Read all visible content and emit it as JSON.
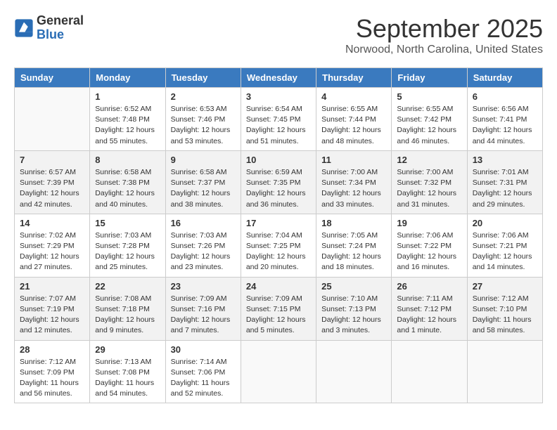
{
  "header": {
    "logo_general": "General",
    "logo_blue": "Blue",
    "month_title": "September 2025",
    "location": "Norwood, North Carolina, United States"
  },
  "days_of_week": [
    "Sunday",
    "Monday",
    "Tuesday",
    "Wednesday",
    "Thursday",
    "Friday",
    "Saturday"
  ],
  "weeks": [
    [
      {
        "day": "",
        "info": ""
      },
      {
        "day": "1",
        "info": "Sunrise: 6:52 AM\nSunset: 7:48 PM\nDaylight: 12 hours\nand 55 minutes."
      },
      {
        "day": "2",
        "info": "Sunrise: 6:53 AM\nSunset: 7:46 PM\nDaylight: 12 hours\nand 53 minutes."
      },
      {
        "day": "3",
        "info": "Sunrise: 6:54 AM\nSunset: 7:45 PM\nDaylight: 12 hours\nand 51 minutes."
      },
      {
        "day": "4",
        "info": "Sunrise: 6:55 AM\nSunset: 7:44 PM\nDaylight: 12 hours\nand 48 minutes."
      },
      {
        "day": "5",
        "info": "Sunrise: 6:55 AM\nSunset: 7:42 PM\nDaylight: 12 hours\nand 46 minutes."
      },
      {
        "day": "6",
        "info": "Sunrise: 6:56 AM\nSunset: 7:41 PM\nDaylight: 12 hours\nand 44 minutes."
      }
    ],
    [
      {
        "day": "7",
        "info": "Sunrise: 6:57 AM\nSunset: 7:39 PM\nDaylight: 12 hours\nand 42 minutes."
      },
      {
        "day": "8",
        "info": "Sunrise: 6:58 AM\nSunset: 7:38 PM\nDaylight: 12 hours\nand 40 minutes."
      },
      {
        "day": "9",
        "info": "Sunrise: 6:58 AM\nSunset: 7:37 PM\nDaylight: 12 hours\nand 38 minutes."
      },
      {
        "day": "10",
        "info": "Sunrise: 6:59 AM\nSunset: 7:35 PM\nDaylight: 12 hours\nand 36 minutes."
      },
      {
        "day": "11",
        "info": "Sunrise: 7:00 AM\nSunset: 7:34 PM\nDaylight: 12 hours\nand 33 minutes."
      },
      {
        "day": "12",
        "info": "Sunrise: 7:00 AM\nSunset: 7:32 PM\nDaylight: 12 hours\nand 31 minutes."
      },
      {
        "day": "13",
        "info": "Sunrise: 7:01 AM\nSunset: 7:31 PM\nDaylight: 12 hours\nand 29 minutes."
      }
    ],
    [
      {
        "day": "14",
        "info": "Sunrise: 7:02 AM\nSunset: 7:29 PM\nDaylight: 12 hours\nand 27 minutes."
      },
      {
        "day": "15",
        "info": "Sunrise: 7:03 AM\nSunset: 7:28 PM\nDaylight: 12 hours\nand 25 minutes."
      },
      {
        "day": "16",
        "info": "Sunrise: 7:03 AM\nSunset: 7:26 PM\nDaylight: 12 hours\nand 23 minutes."
      },
      {
        "day": "17",
        "info": "Sunrise: 7:04 AM\nSunset: 7:25 PM\nDaylight: 12 hours\nand 20 minutes."
      },
      {
        "day": "18",
        "info": "Sunrise: 7:05 AM\nSunset: 7:24 PM\nDaylight: 12 hours\nand 18 minutes."
      },
      {
        "day": "19",
        "info": "Sunrise: 7:06 AM\nSunset: 7:22 PM\nDaylight: 12 hours\nand 16 minutes."
      },
      {
        "day": "20",
        "info": "Sunrise: 7:06 AM\nSunset: 7:21 PM\nDaylight: 12 hours\nand 14 minutes."
      }
    ],
    [
      {
        "day": "21",
        "info": "Sunrise: 7:07 AM\nSunset: 7:19 PM\nDaylight: 12 hours\nand 12 minutes."
      },
      {
        "day": "22",
        "info": "Sunrise: 7:08 AM\nSunset: 7:18 PM\nDaylight: 12 hours\nand 9 minutes."
      },
      {
        "day": "23",
        "info": "Sunrise: 7:09 AM\nSunset: 7:16 PM\nDaylight: 12 hours\nand 7 minutes."
      },
      {
        "day": "24",
        "info": "Sunrise: 7:09 AM\nSunset: 7:15 PM\nDaylight: 12 hours\nand 5 minutes."
      },
      {
        "day": "25",
        "info": "Sunrise: 7:10 AM\nSunset: 7:13 PM\nDaylight: 12 hours\nand 3 minutes."
      },
      {
        "day": "26",
        "info": "Sunrise: 7:11 AM\nSunset: 7:12 PM\nDaylight: 12 hours\nand 1 minute."
      },
      {
        "day": "27",
        "info": "Sunrise: 7:12 AM\nSunset: 7:10 PM\nDaylight: 11 hours\nand 58 minutes."
      }
    ],
    [
      {
        "day": "28",
        "info": "Sunrise: 7:12 AM\nSunset: 7:09 PM\nDaylight: 11 hours\nand 56 minutes."
      },
      {
        "day": "29",
        "info": "Sunrise: 7:13 AM\nSunset: 7:08 PM\nDaylight: 11 hours\nand 54 minutes."
      },
      {
        "day": "30",
        "info": "Sunrise: 7:14 AM\nSunset: 7:06 PM\nDaylight: 11 hours\nand 52 minutes."
      },
      {
        "day": "",
        "info": ""
      },
      {
        "day": "",
        "info": ""
      },
      {
        "day": "",
        "info": ""
      },
      {
        "day": "",
        "info": ""
      }
    ]
  ]
}
